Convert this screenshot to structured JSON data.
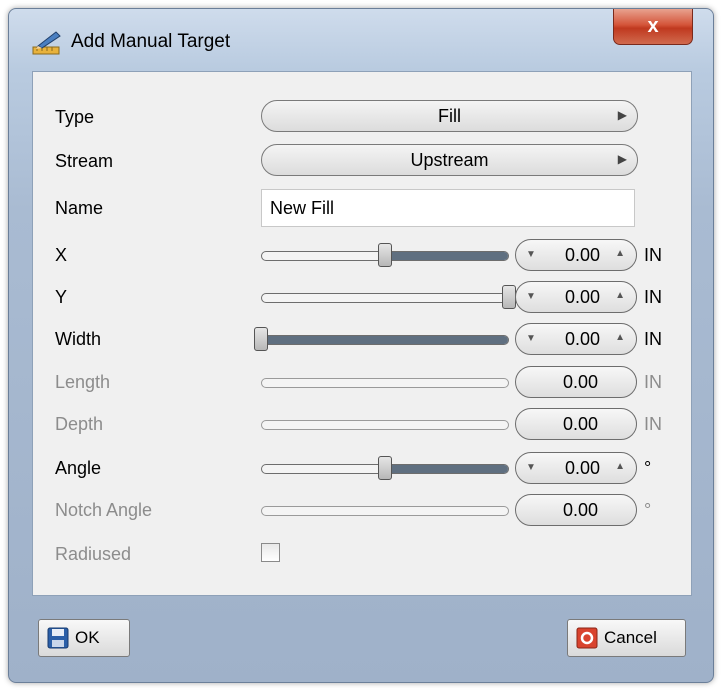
{
  "window": {
    "title": "Add Manual Target",
    "close_label": "x"
  },
  "form": {
    "type": {
      "label": "Type",
      "value": "Fill",
      "arrow": "▶"
    },
    "stream": {
      "label": "Stream",
      "value": "Upstream",
      "arrow": "▶"
    },
    "name": {
      "label": "Name",
      "value": "New Fill"
    },
    "x": {
      "label": "X",
      "value": "0.00",
      "unit": "IN",
      "slider_fraction": 0.5
    },
    "y": {
      "label": "Y",
      "value": "0.00",
      "unit": "IN",
      "slider_fraction": 1.0
    },
    "width": {
      "label": "Width",
      "value": "0.00",
      "unit": "IN",
      "slider_fraction": 0.0
    },
    "length": {
      "label": "Length",
      "value": "0.00",
      "unit": "IN",
      "enabled": false
    },
    "depth": {
      "label": "Depth",
      "value": "0.00",
      "unit": "IN",
      "enabled": false
    },
    "angle": {
      "label": "Angle",
      "value": "0.00",
      "unit": "°",
      "slider_fraction": 0.5
    },
    "notch_angle": {
      "label": "Notch Angle",
      "value": "0.00",
      "unit": "°",
      "enabled": false
    },
    "radiused": {
      "label": "Radiused",
      "checked": false,
      "enabled": false
    }
  },
  "buttons": {
    "ok": "OK",
    "cancel": "Cancel"
  },
  "spin": {
    "down": "▼",
    "up": "▲"
  }
}
